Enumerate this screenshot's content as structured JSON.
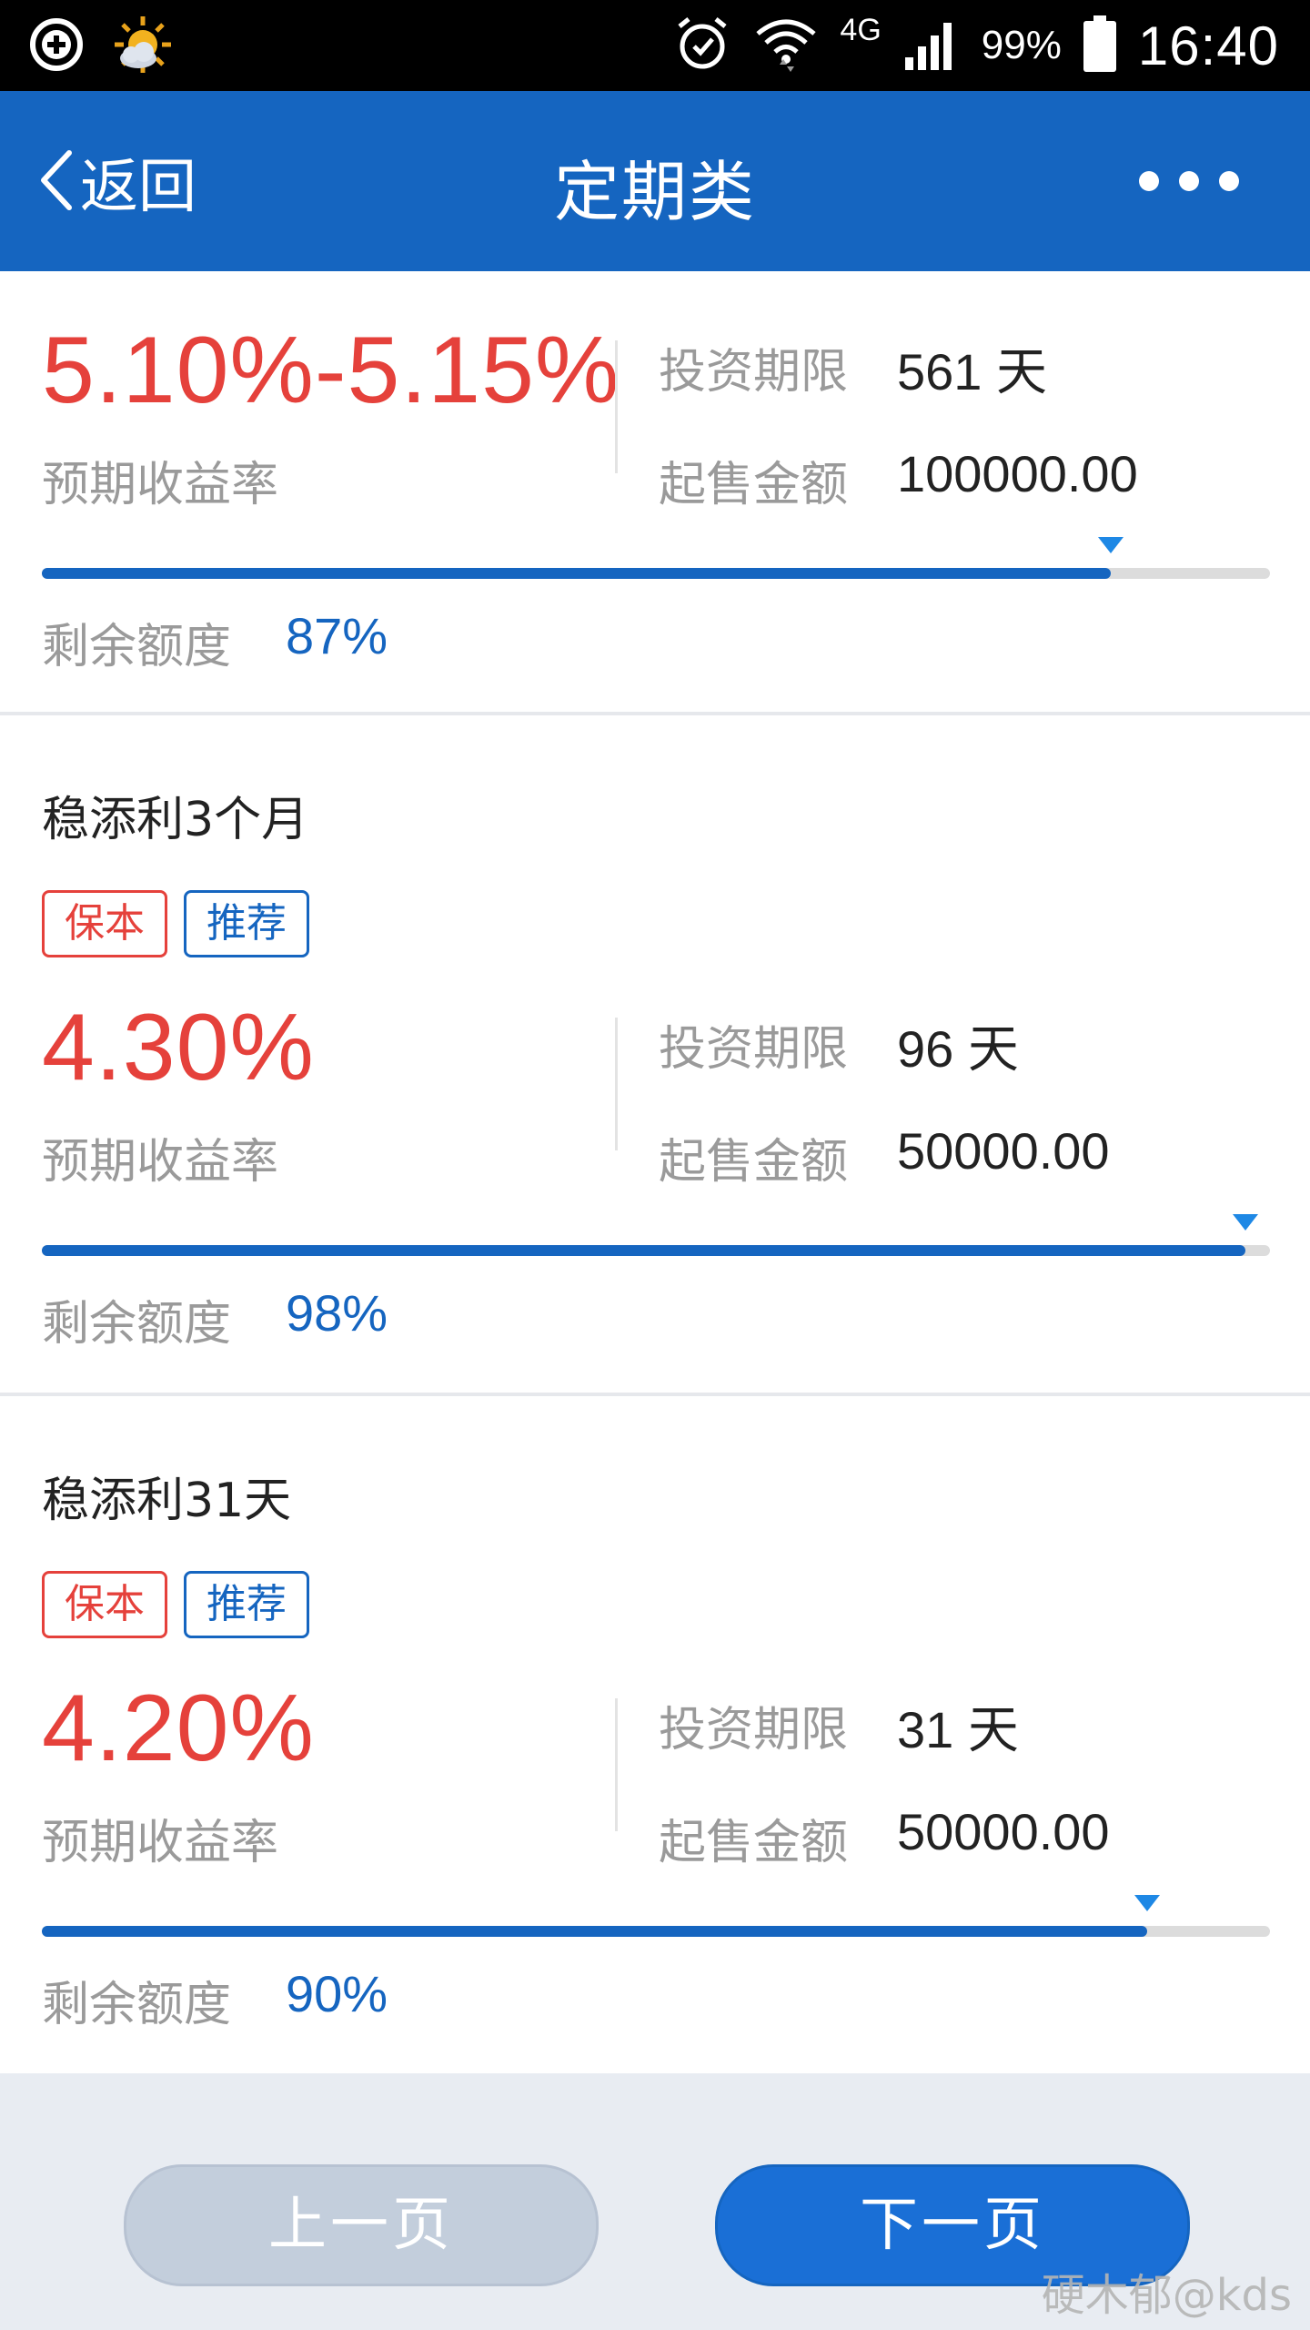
{
  "status_bar": {
    "left_icons": [
      "add-circle-icon",
      "weather-sun-cloud-icon"
    ],
    "right_icons": [
      "alarm-icon",
      "wifi-icon",
      "signal-icon",
      "battery-icon"
    ],
    "network_type": "4G",
    "battery_percent": "99%",
    "time": "16:40"
  },
  "header": {
    "back_label": "返回",
    "title": "定期类",
    "more_icon": "more-dots-icon",
    "color": "#1565c0"
  },
  "products": [
    {
      "title": "",
      "tags": [],
      "rate": "5.10%-5.15%",
      "rate_label": "预期收益率",
      "term_label": "投资期限",
      "term_value": "561 天",
      "min_amount_label": "起售金额",
      "min_amount_value": "100000.00",
      "remaining_label": "剩余额度",
      "remaining_value": "87%",
      "progress_fraction": 0.87
    },
    {
      "title": "稳添利3个月",
      "tags": [
        "保本",
        "推荐"
      ],
      "rate": "4.30%",
      "rate_label": "预期收益率",
      "term_label": "投资期限",
      "term_value": "96 天",
      "min_amount_label": "起售金额",
      "min_amount_value": "50000.00",
      "remaining_label": "剩余额度",
      "remaining_value": "98%",
      "progress_fraction": 0.98
    },
    {
      "title": "稳添利31天",
      "tags": [
        "保本",
        "推荐"
      ],
      "rate": "4.20%",
      "rate_label": "预期收益率",
      "term_label": "投资期限",
      "term_value": "31 天",
      "min_amount_label": "起售金额",
      "min_amount_value": "50000.00",
      "remaining_label": "剩余额度",
      "remaining_value": "90%",
      "progress_fraction": 0.9
    }
  ],
  "pager": {
    "prev_label": "上一页",
    "next_label": "下一页"
  },
  "watermark": "硬木郁@kds",
  "colors": {
    "rate_red": "#e5413b",
    "accent_blue": "#1565c0",
    "progress_marker": "#1e88e5"
  }
}
